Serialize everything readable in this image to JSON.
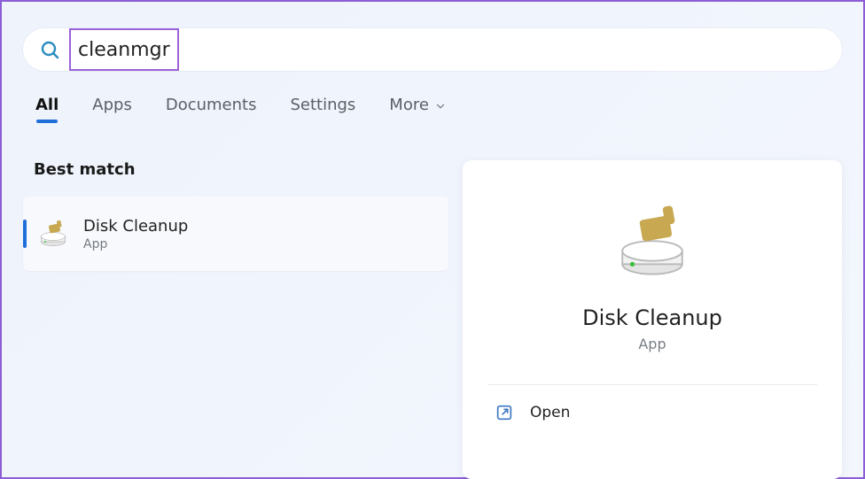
{
  "search": {
    "query": "cleanmgr"
  },
  "tabs": {
    "all": "All",
    "apps": "Apps",
    "documents": "Documents",
    "settings": "Settings",
    "more": "More"
  },
  "best_match_label": "Best match",
  "result": {
    "title": "Disk Cleanup",
    "subtitle": "App"
  },
  "detail": {
    "title": "Disk Cleanup",
    "subtitle": "App",
    "open_label": "Open"
  }
}
